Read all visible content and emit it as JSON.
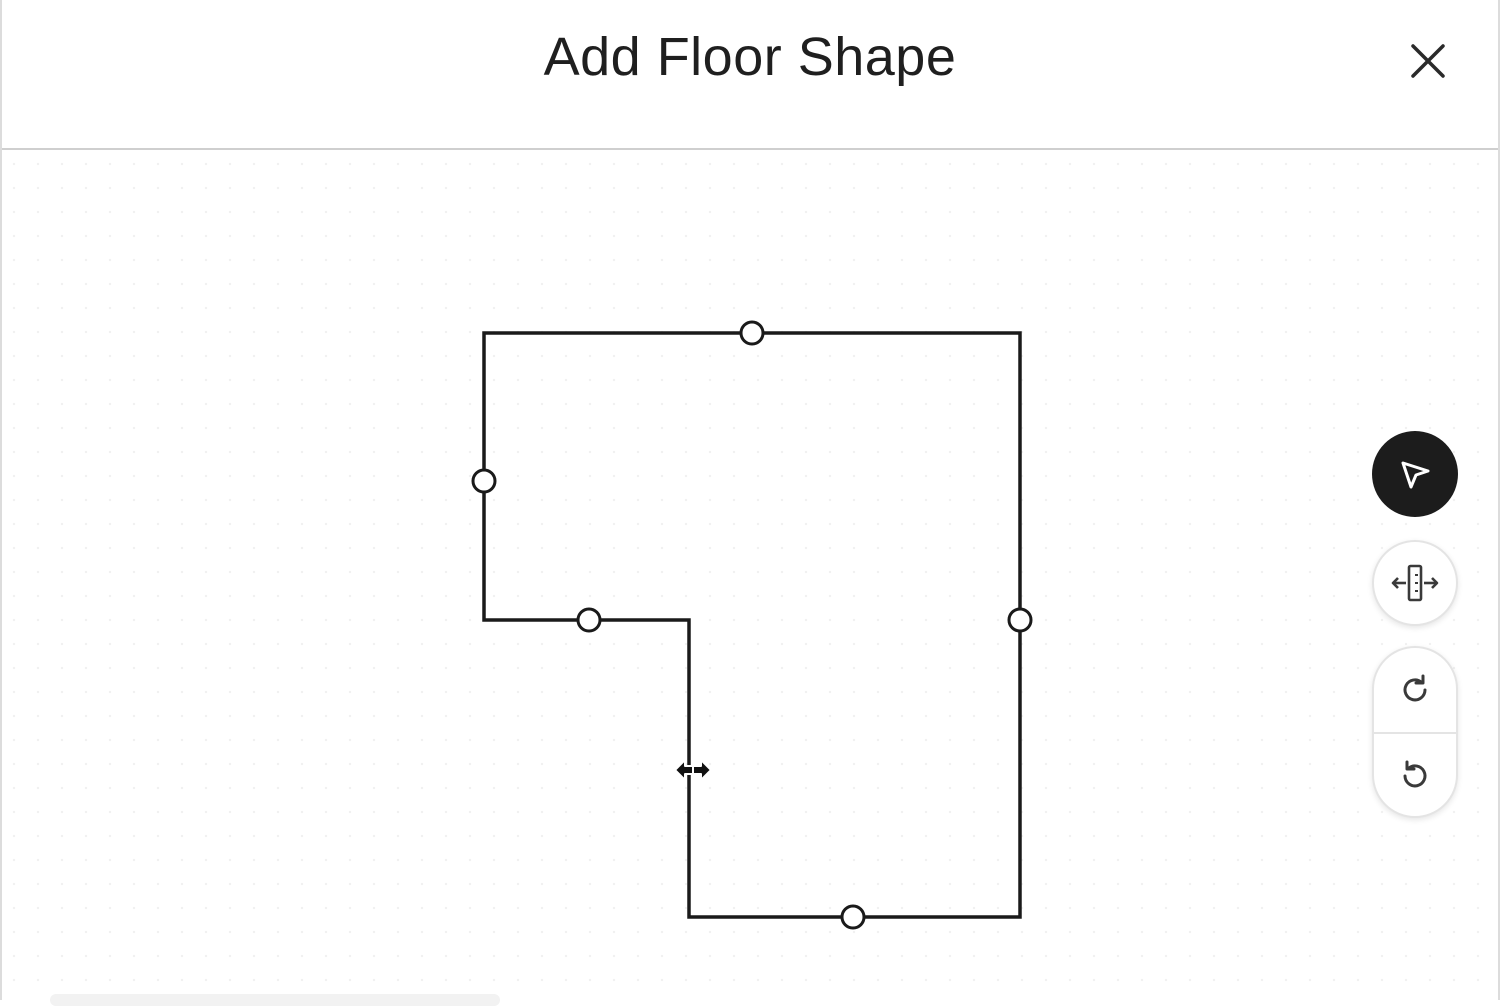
{
  "header": {
    "title": "Add Floor Shape",
    "close_icon": "close-icon"
  },
  "toolbar": {
    "tools": [
      {
        "name": "select",
        "icon": "cursor-arrow-icon",
        "active": true
      },
      {
        "name": "split-wall",
        "icon": "split-wall-icon",
        "active": false
      },
      {
        "name": "redo",
        "icon": "redo-icon",
        "active": false
      },
      {
        "name": "undo",
        "icon": "undo-icon",
        "active": false
      }
    ]
  },
  "canvas": {
    "shape": "floor-outline",
    "cursor": "resize-horizontal-cursor-icon"
  },
  "colors": {
    "title_text": "#1f1f1f",
    "outline": "#1a1a1a",
    "active_tool_bg": "#1c1c1c",
    "tool_border": "#e4e4e4"
  }
}
